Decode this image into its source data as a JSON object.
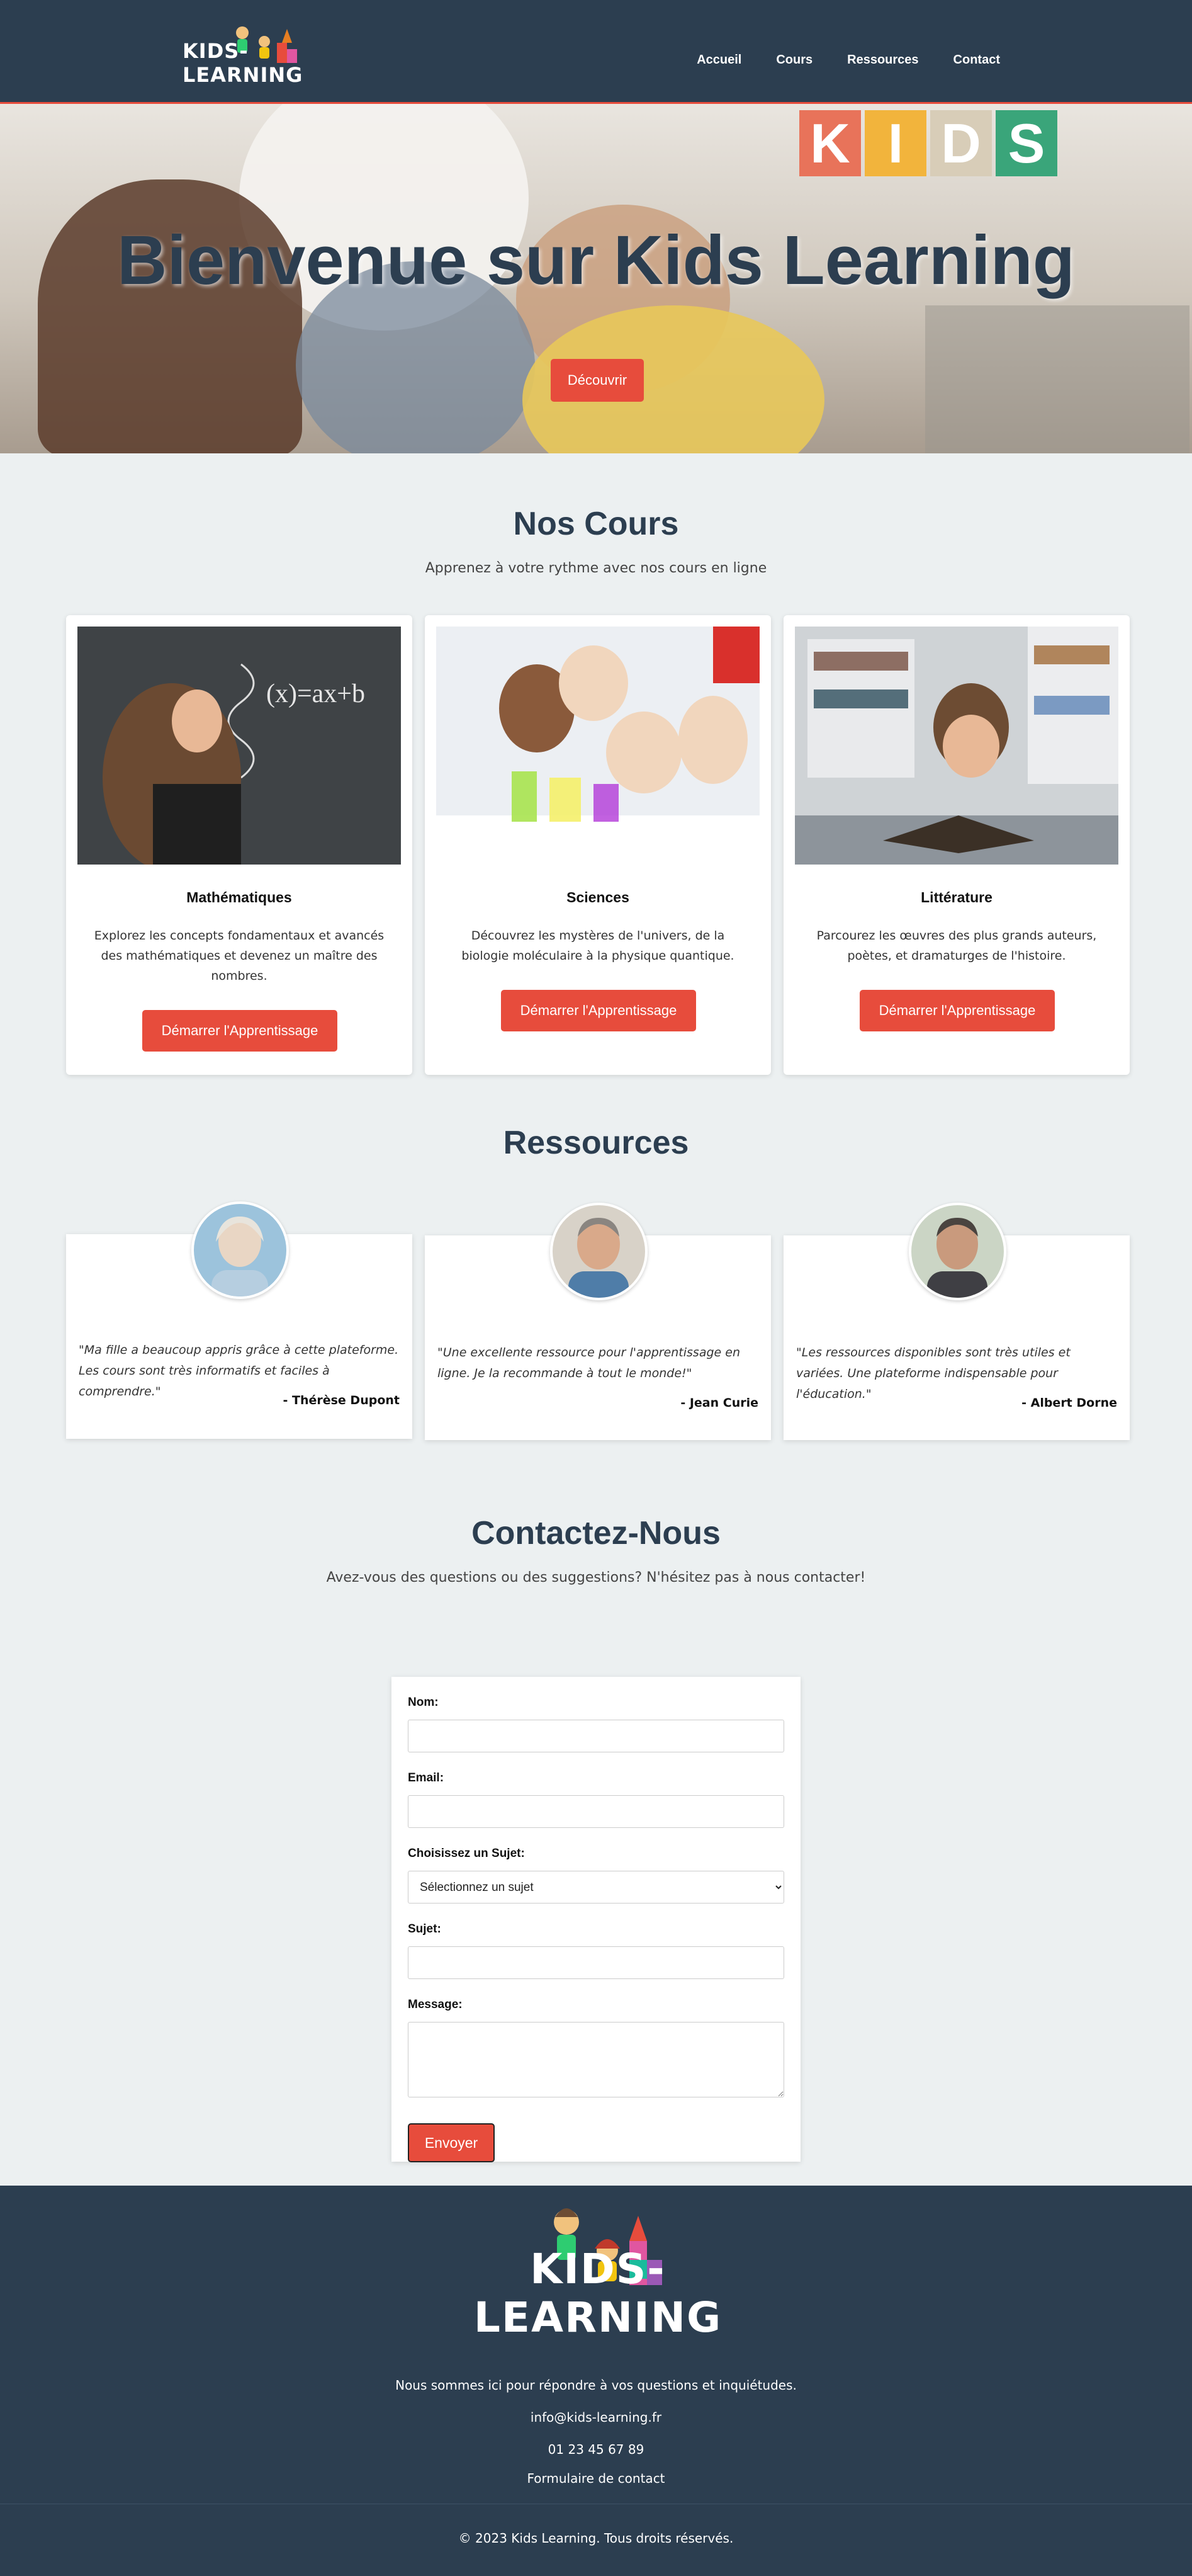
{
  "brand": {
    "logo_text": "KIDS-LEARNING"
  },
  "nav": {
    "items": [
      "Accueil",
      "Cours",
      "Ressources",
      "Contact"
    ]
  },
  "hero": {
    "title": "Bienvenue sur Kids Learning",
    "button": "Découvrir",
    "blocks": [
      "K",
      "I",
      "D",
      "S"
    ],
    "block_colors": [
      "#e8735a",
      "#f2b43c",
      "#d8cdb8",
      "#3aa57a"
    ]
  },
  "courses": {
    "title": "Nos Cours",
    "subtitle": "Apprenez à votre rythme avec nos cours en ligne",
    "items": [
      {
        "title": "Mathématiques",
        "description": "Explorez les concepts fondamentaux et avancés des mathématiques et devenez un maître des nombres.",
        "button": "Démarrer l'Apprentissage",
        "image": "chalkboard-girl"
      },
      {
        "title": "Sciences",
        "description": "Découvrez les mystères de l'univers, de la biologie moléculaire à la physique quantique.",
        "button": "Démarrer l'Apprentissage",
        "image": "science-kids"
      },
      {
        "title": "Littérature",
        "description": "Parcourez les œuvres des plus grands auteurs, poètes, et dramaturges de l'histoire.",
        "button": "Démarrer l'Apprentissage",
        "image": "reading-boy"
      }
    ]
  },
  "resources": {
    "title": "Ressources",
    "items": [
      {
        "quote": "\"Ma fille a beaucoup appris grâce à cette plateforme. Les cours sont très informatifs et faciles à comprendre.\"",
        "author": "- Thérèse Dupont"
      },
      {
        "quote": "\"Une excellente ressource pour l'apprentissage en ligne. Je la recommande à tout le monde!\"",
        "author": "- Jean Curie"
      },
      {
        "quote": "\"Les ressources disponibles sont très utiles et variées. Une plateforme indispensable pour l'éducation.\"",
        "author": "- Albert Dorne"
      }
    ]
  },
  "contact": {
    "title": "Contactez-Nous",
    "subtitle": "Avez-vous des questions ou des suggestions? N'hésitez pas à nous contacter!",
    "labels": {
      "name": "Nom:",
      "email": "Email:",
      "topic": "Choisissez un Sujet:",
      "subject": "Sujet:",
      "message": "Message:"
    },
    "topic_selected": "Sélectionnez un sujet",
    "send": "Envoyer"
  },
  "footer": {
    "tagline": "Nous sommes ici pour répondre à vos questions et inquiétudes.",
    "email": "info@kids-learning.fr",
    "phone": "01 23 45 67 89",
    "form_link": "Formulaire de contact",
    "copyright": "© 2023 Kids Learning. Tous droits réservés."
  },
  "colors": {
    "primary": "#2c3e50",
    "accent": "#e74c3c",
    "background": "#ecf0f1"
  }
}
